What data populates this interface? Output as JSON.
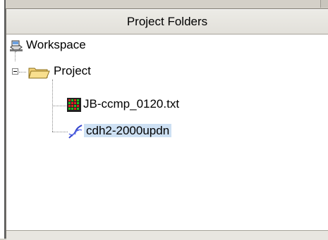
{
  "panel": {
    "title": "Project Folders"
  },
  "tree": {
    "workspace": {
      "label": "Workspace",
      "icon": "workspace-icon"
    },
    "project": {
      "label": "Project",
      "icon": "open-folder-icon",
      "expanded": true
    },
    "items": [
      {
        "label": "JB-ccmp_0120.txt",
        "icon": "heatmap-data-icon",
        "selected": false
      },
      {
        "label": "cdh2-2000updn",
        "icon": "dna-helix-icon",
        "selected": true
      }
    ]
  },
  "colors": {
    "selection": "#cde0f3",
    "header": "#e6e4df",
    "heatmap_red": "#e02020",
    "heatmap_green": "#20c020",
    "dna": "#3344cc"
  }
}
